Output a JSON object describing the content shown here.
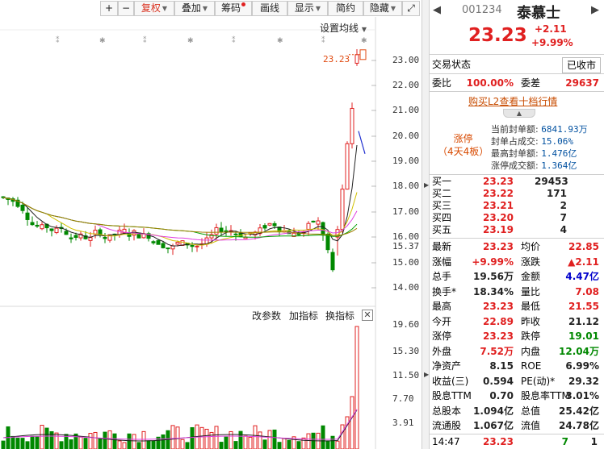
{
  "toolbar": {
    "items": [
      {
        "label": "+",
        "x": 124,
        "w": 22
      },
      {
        "label": "−",
        "x": 146,
        "w": 20
      },
      {
        "label": "复权",
        "x": 166,
        "w": 50,
        "selected": true,
        "arrow": true
      },
      {
        "label": "叠加",
        "x": 216,
        "w": 50,
        "arrow": true
      },
      {
        "label": "筹码",
        "x": 266,
        "w": 46,
        "dot": true
      },
      {
        "label": "画线",
        "x": 312,
        "w": 44
      },
      {
        "label": "显示",
        "x": 356,
        "w": 50,
        "arrow": true
      },
      {
        "label": "简约",
        "x": 406,
        "w": 44
      },
      {
        "label": "隐藏",
        "x": 450,
        "w": 48,
        "arrow": true
      },
      {
        "label": "⤢",
        "x": 498,
        "w": 22
      }
    ]
  },
  "chart": {
    "ma_setting": "设置均线",
    "price_tag": "23.23",
    "y_ticks": [
      "23.00",
      "22.00",
      "21.00",
      "20.00",
      "19.00",
      "18.00",
      "17.00",
      "16.00",
      "15.37",
      "15.00",
      "14.00"
    ],
    "indicator_menu": [
      "改参数",
      "加指标",
      "换指标"
    ],
    "volume_ticks": [
      "19.60",
      "15.30",
      "11.50",
      "7.70",
      "3.91"
    ],
    "colors": {
      "up": "#e02020",
      "down": "#008800",
      "ma5": "#202020",
      "ma10": "#d0c000",
      "ma20": "#e040e0",
      "ma60": "#00a000",
      "ma120": "#a08000"
    }
  },
  "quote": {
    "code": "001234",
    "name": "泰慕士",
    "price": "23.23",
    "change": "+2.11",
    "change_pct": "+9.99%",
    "trade_status_label": "交易状态",
    "trade_status": "已收市",
    "weibi_label": "委比",
    "weibi": "100.00%",
    "weicha_label": "委差",
    "weicha": "29637",
    "l2_link": "购买L2查看十档行情",
    "limit": {
      "tag": "涨停",
      "boards": "（4天4板）",
      "rows": [
        {
          "label": "当前封单额:",
          "value": "6841.93万"
        },
        {
          "label": "封单占成交:",
          "value": "15.06%"
        },
        {
          "label": "最高封单额:",
          "value": "1.476亿"
        },
        {
          "label": "涨停成交额:",
          "value": "1.364亿"
        }
      ]
    },
    "book": [
      {
        "label": "买一",
        "price": "23.23",
        "vol": "29453"
      },
      {
        "label": "买二",
        "price": "23.22",
        "vol": "171"
      },
      {
        "label": "买三",
        "price": "23.21",
        "vol": "2"
      },
      {
        "label": "买四",
        "price": "23.20",
        "vol": "7"
      },
      {
        "label": "买五",
        "price": "23.19",
        "vol": "4"
      }
    ],
    "stats": [
      {
        "l1": "最新",
        "v1": "23.23",
        "c1": "red",
        "l2": "均价",
        "v2": "22.85",
        "c2": "red"
      },
      {
        "l1": "涨幅",
        "v1": "+9.99%",
        "c1": "red",
        "l2": "涨跌",
        "v2": "▲2.11",
        "c2": "red"
      },
      {
        "l1": "总手",
        "v1": "19.56万",
        "c1": "dark",
        "l2": "金额",
        "v2": "4.47亿",
        "c2": "blue"
      },
      {
        "l1": "换手*",
        "v1": "18.34%",
        "c1": "dark",
        "l2": "量比",
        "v2": "7.08",
        "c2": "red"
      },
      {
        "l1": "最高",
        "v1": "23.23",
        "c1": "red",
        "l2": "最低",
        "v2": "21.55",
        "c2": "red"
      },
      {
        "l1": "今开",
        "v1": "22.89",
        "c1": "red",
        "l2": "昨收",
        "v2": "21.12",
        "c2": "dark"
      },
      {
        "l1": "涨停",
        "v1": "23.23",
        "c1": "red",
        "l2": "跌停",
        "v2": "19.01",
        "c2": "green"
      },
      {
        "l1": "外盘",
        "v1": "7.52万",
        "c1": "red",
        "l2": "内盘",
        "v2": "12.04万",
        "c2": "green"
      },
      {
        "l1": "净资产",
        "v1": "8.15",
        "c1": "dark",
        "l2": "ROE",
        "v2": "6.99%",
        "c2": "dark"
      },
      {
        "l1": "收益(三)",
        "v1": "0.594",
        "c1": "dark",
        "l2": "PE(动)*",
        "v2": "29.32",
        "c2": "dark"
      },
      {
        "l1": "股息TTM",
        "v1": "0.70",
        "c1": "dark",
        "l2": "股息率TTM",
        "v2": "3.01%",
        "c2": "dark"
      },
      {
        "l1": "总股本",
        "v1": "1.094亿",
        "c1": "dark",
        "l2": "总值",
        "v2": "25.42亿",
        "c2": "dark"
      },
      {
        "l1": "流通股",
        "v1": "1.067亿",
        "c1": "dark",
        "l2": "流值",
        "v2": "24.78亿",
        "c2": "dark"
      }
    ],
    "tick": {
      "time": "14:47",
      "price": "23.23",
      "vol": "7",
      "count": "1"
    }
  }
}
